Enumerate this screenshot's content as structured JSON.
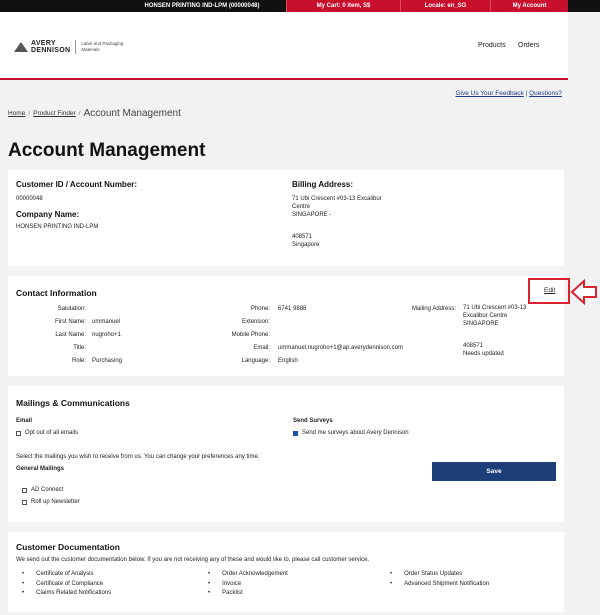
{
  "topbar": {
    "account": "HONSEN PRINTING IND-LPM (00000048)",
    "cart": "My Cart: 0 item, S$",
    "locale": "Locale: en_SG",
    "my_account": "My Account"
  },
  "header": {
    "brand_name_1": "AVERY",
    "brand_name_2": "DENNISON",
    "brand_tagline": "Label and Packaging Materials",
    "nav": [
      "Products",
      "Orders"
    ]
  },
  "links": {
    "feedback": "Give Us Your Feedback",
    "separator": " | ",
    "questions": "Questions?"
  },
  "breadcrumb": {
    "items": [
      "Home",
      "Product Finder"
    ],
    "separator": "/",
    "current": "Account Management"
  },
  "page_title": "Account Management",
  "account": {
    "customer_id_label": "Customer ID / Account Number:",
    "customer_id": "00000048",
    "company_label": "Company Name:",
    "company": "HONSEN PRINTING IND-LPM",
    "billing_label": "Billing Address:",
    "billing_line1": "71 Ubi Crescent #03-13 Excalibur",
    "billing_line2": "Centre",
    "billing_line3": "SINGAPORE -",
    "billing_postal": "408571",
    "billing_country": "Singapore"
  },
  "contact": {
    "title": "Contact Information",
    "edit": "Edit",
    "salutation_label": "Salutation:",
    "salutation": "",
    "first_name_label": "First Name:",
    "first_name": "ummanuel",
    "last_name_label": "Last Name:",
    "last_name": "nugroho+1",
    "title_label": "Title:",
    "title_value": "",
    "role_label": "Role:",
    "role": "Purchasing",
    "phone_label": "Phone:",
    "phone": "6741 9888",
    "extension_label": "Extension:",
    "extension": "",
    "mobile_label": "Mobile Phone:",
    "mobile": "",
    "email_label": "Email:",
    "email": "ummanuel.nugroho+1@ap.averydennison.com",
    "language_label": "Language:",
    "language": "English",
    "mailing_label": "Mailing Address:",
    "mailing_line1": "71 Ubi Crescent #03-13",
    "mailing_line2": "Excalibur Centre",
    "mailing_line3": "SINGAPORE",
    "mailing_postal": "408571",
    "mailing_note": "Needs updated"
  },
  "mailings": {
    "title": "Mailings & Communications",
    "email_label": "Email",
    "opt_out": "Opt out of all emails",
    "opt_out_checked": false,
    "surveys_label": "Send Surveys",
    "surveys": "Send me surveys about Avery Dennison",
    "surveys_checked": true,
    "instruction": "Select the mailings you wish to receive from us. You can change your preferences any time.",
    "general_label": "General Mailings",
    "ad_connect": "AD Connect",
    "roll_up": "Roll up Newsletter",
    "save": "Save"
  },
  "documentation": {
    "title": "Customer Documentation",
    "intro": "We send out the customer documentation below. If you are not receiving any of these and would like to, please call customer service.",
    "col1": [
      "Certificate of Analysis",
      "Certificate of Compliance",
      "Claims Related Notifications"
    ],
    "col2": [
      "Order Acknowledgement",
      "Invoice",
      "Packlist"
    ],
    "col3": [
      "Order Status Updates",
      "Advanced Shipment Notification"
    ]
  },
  "colors": {
    "brand_red": "#c8102e",
    "button_navy": "#1c3f7a",
    "highlight_red": "#d9232e"
  }
}
